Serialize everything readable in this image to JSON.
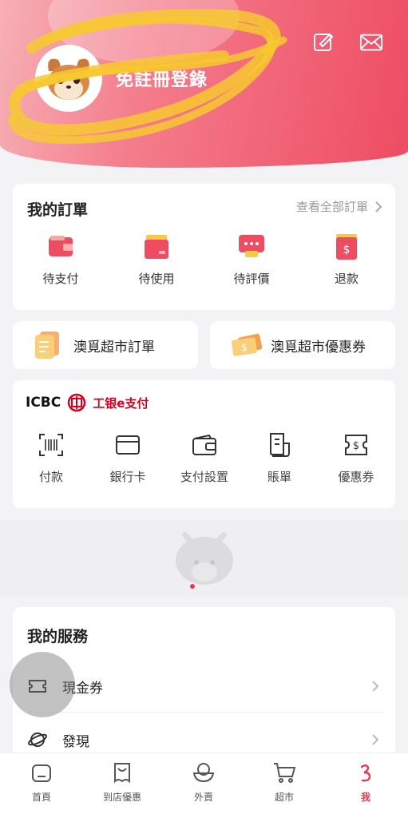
{
  "header": {
    "login_label": "免註冊登錄",
    "edit_icon": "edit-icon",
    "mail_icon": "mail-icon"
  },
  "orders": {
    "title": "我的訂單",
    "view_all": "查看全部訂單",
    "items": [
      {
        "label": "待支付",
        "icon": "wallet-icon"
      },
      {
        "label": "待使用",
        "icon": "ticket-icon"
      },
      {
        "label": "待評價",
        "icon": "comment-icon"
      },
      {
        "label": "退款",
        "icon": "refund-icon"
      }
    ]
  },
  "supermarket": {
    "orders_label": "澳覓超市訂單",
    "coupons_label": "澳覓超市優惠券"
  },
  "icbc": {
    "brand": "ICBC",
    "brand_cn": "工银e支付",
    "items": [
      {
        "label": "付款",
        "icon": "barcode-scan-icon"
      },
      {
        "label": "銀行卡",
        "icon": "bank-card-icon"
      },
      {
        "label": "支付設置",
        "icon": "wallet-settings-icon"
      },
      {
        "label": "賬單",
        "icon": "bill-icon"
      },
      {
        "label": "優惠券",
        "icon": "coupon-icon"
      }
    ]
  },
  "services": {
    "title": "我的服務",
    "items": [
      {
        "label": "現金券",
        "icon": "cash-coupon-icon"
      },
      {
        "label": "發現",
        "icon": "planet-icon"
      }
    ]
  },
  "tabs": [
    {
      "label": "首頁",
      "icon": "home-icon"
    },
    {
      "label": "到店優惠",
      "icon": "store-coupon-icon"
    },
    {
      "label": "外賣",
      "icon": "takeout-icon"
    },
    {
      "label": "超市",
      "icon": "cart-icon"
    },
    {
      "label": "我",
      "icon": "me-icon",
      "active": true
    }
  ],
  "colors": {
    "accent": "#e8384f",
    "header_start": "#f7b0b6",
    "header_end": "#ee4c63"
  }
}
